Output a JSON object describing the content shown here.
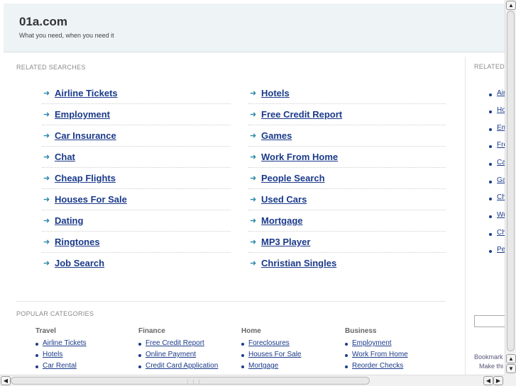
{
  "header": {
    "site_title": "01a.com",
    "tagline": "What you need, when you need it"
  },
  "related_searches": {
    "heading": "RELATED SEARCHES",
    "left": [
      "Airline Tickets",
      "Employment",
      "Car Insurance",
      "Chat",
      "Cheap Flights",
      "Houses For Sale",
      "Dating",
      "Ringtones",
      "Job Search"
    ],
    "right": [
      "Hotels",
      "Free Credit Report",
      "Games",
      "Work From Home",
      "People Search",
      "Used Cars",
      "Mortgage",
      "MP3 Player",
      "Christian Singles"
    ]
  },
  "popular_categories": {
    "heading": "POPULAR CATEGORIES",
    "columns": [
      {
        "title": "Travel",
        "items": [
          "Airline Tickets",
          "Hotels",
          "Car Rental"
        ]
      },
      {
        "title": "Finance",
        "items": [
          "Free Credit Report",
          "Online Payment",
          "Credit Card Application"
        ]
      },
      {
        "title": "Home",
        "items": [
          "Foreclosures",
          "Houses For Sale",
          "Mortgage"
        ]
      },
      {
        "title": "Business",
        "items": [
          "Employment",
          "Work From Home",
          "Reorder Checks"
        ]
      }
    ]
  },
  "sidebar": {
    "heading": "RELATED",
    "items": [
      "Air",
      "Ho",
      "Em",
      "Fre",
      "Ca",
      "Ga",
      "Ch",
      "Wo",
      "Ch",
      "Pe"
    ],
    "bookmark_text": "Bookmark",
    "make_text": "Make thi"
  },
  "colors": {
    "link": "#1a3a8a",
    "arrow": "#2a86a8",
    "header_bg": "#eef3f6"
  },
  "icons": {
    "arrow": "arrow-right-icon",
    "bullet": "bullet-icon"
  }
}
